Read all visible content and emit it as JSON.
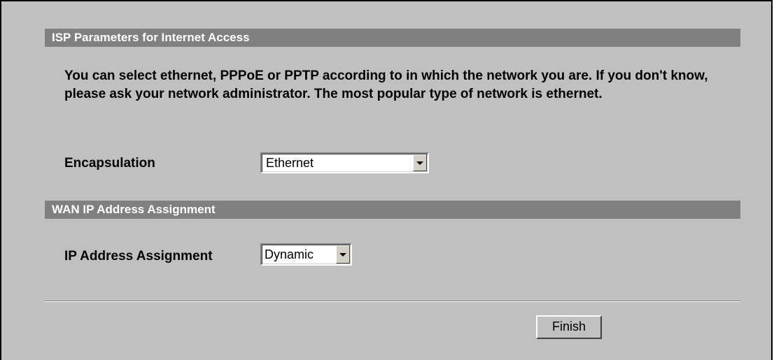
{
  "isp_section": {
    "title": "ISP Parameters for Internet Access",
    "description": "You can select ethernet, PPPoE or PPTP according to in which the network you are. If you don't know, please ask your network administrator. The most popular type of network is ethernet.",
    "encapsulation": {
      "label": "Encapsulation",
      "selected": "Ethernet"
    }
  },
  "wan_section": {
    "title": "WAN IP Address Assignment",
    "ip_assignment": {
      "label": "IP Address Assignment",
      "selected": "Dynamic"
    }
  },
  "actions": {
    "finish_label": "Finish"
  },
  "colors": {
    "panel_background": "#c0c0c0",
    "section_bar": "#808080",
    "section_bar_text": "#ffffff"
  },
  "icons": {
    "dropdown": "chevron-down-icon"
  }
}
